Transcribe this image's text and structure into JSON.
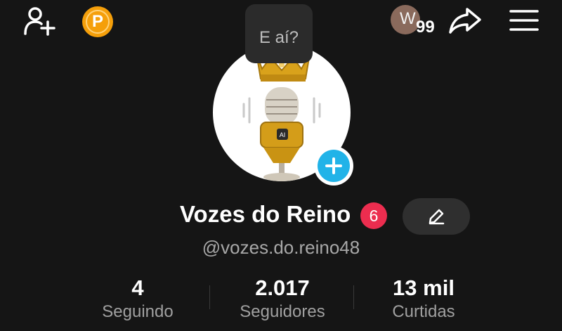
{
  "header": {
    "avatar_letter": "W",
    "notification_count": "99"
  },
  "tooltip": {
    "text": "E aí?"
  },
  "profile": {
    "display_name": "Vozes do Reino",
    "badge_count": "6",
    "username": "@vozes.do.reino48"
  },
  "stats": {
    "following": {
      "value": "4",
      "label": "Seguindo"
    },
    "followers": {
      "value": "2.017",
      "label": "Seguidores"
    },
    "likes": {
      "value": "13 mil",
      "label": "Curtidas"
    }
  },
  "icons": {
    "add_user": "add-user-icon",
    "points": "points-coin-icon",
    "share": "share-icon",
    "menu": "menu-icon",
    "edit": "pencil-icon",
    "add_photo": "plus-icon"
  },
  "colors": {
    "background": "#151515",
    "coin": "#f59f0a",
    "badge": "#ec2d4f",
    "add_photo": "#21b3e8",
    "edit_button": "#2f2f2f"
  }
}
